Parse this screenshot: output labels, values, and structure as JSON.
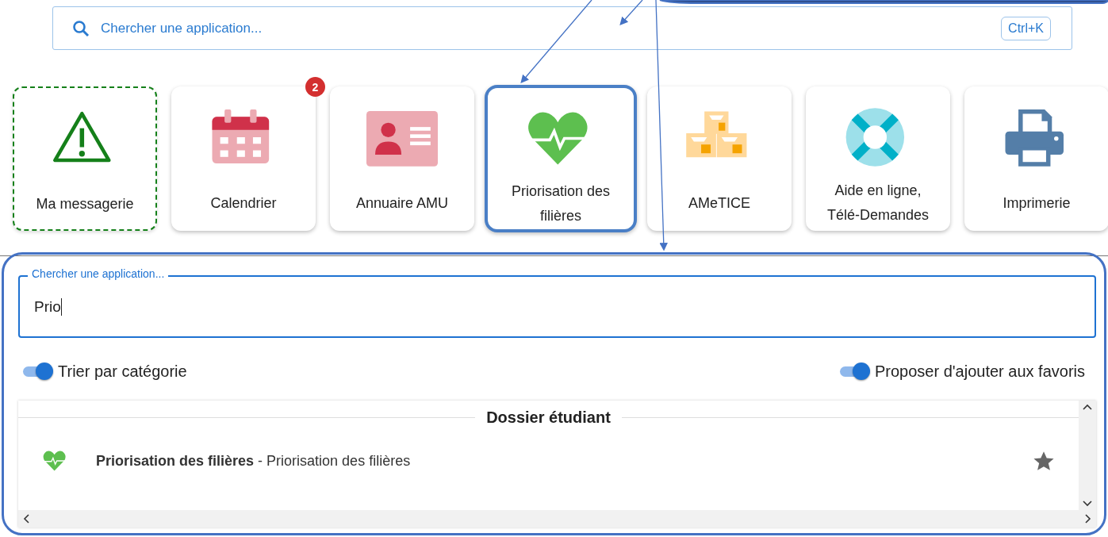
{
  "search": {
    "placeholder": "Chercher une application...",
    "shortcut": "Ctrl+K"
  },
  "apps": [
    {
      "label": "Ma messagerie",
      "kind": "warning",
      "focused": true,
      "highlighted": false
    },
    {
      "label": "Calendrier",
      "kind": "calendar",
      "badge": "2",
      "focused": false,
      "highlighted": false
    },
    {
      "label": "Annuaire AMU",
      "kind": "idcard",
      "focused": false,
      "highlighted": false
    },
    {
      "label": "Priorisation des filières",
      "kind": "heart",
      "focused": false,
      "highlighted": true
    },
    {
      "label": "AMeTICE",
      "kind": "boxes",
      "focused": false,
      "highlighted": false
    },
    {
      "label": "Aide en ligne, Télé-Demandes",
      "kind": "lifebuoy",
      "focused": false,
      "highlighted": false
    },
    {
      "label": "Imprimerie",
      "kind": "printer",
      "focused": false,
      "highlighted": false
    }
  ],
  "panel": {
    "search_field": {
      "label": "Chercher une application...",
      "value": "Prio"
    },
    "toggles": [
      {
        "label": "Trier par catégorie",
        "on": true
      },
      {
        "label": "Proposer d'ajouter aux favoris",
        "on": true
      }
    ],
    "results": {
      "category": "Dossier étudiant",
      "items": [
        {
          "text": "**Priorisation des filières** - Priorisation des filières",
          "kind": "heart",
          "starred": false
        }
      ]
    }
  }
}
